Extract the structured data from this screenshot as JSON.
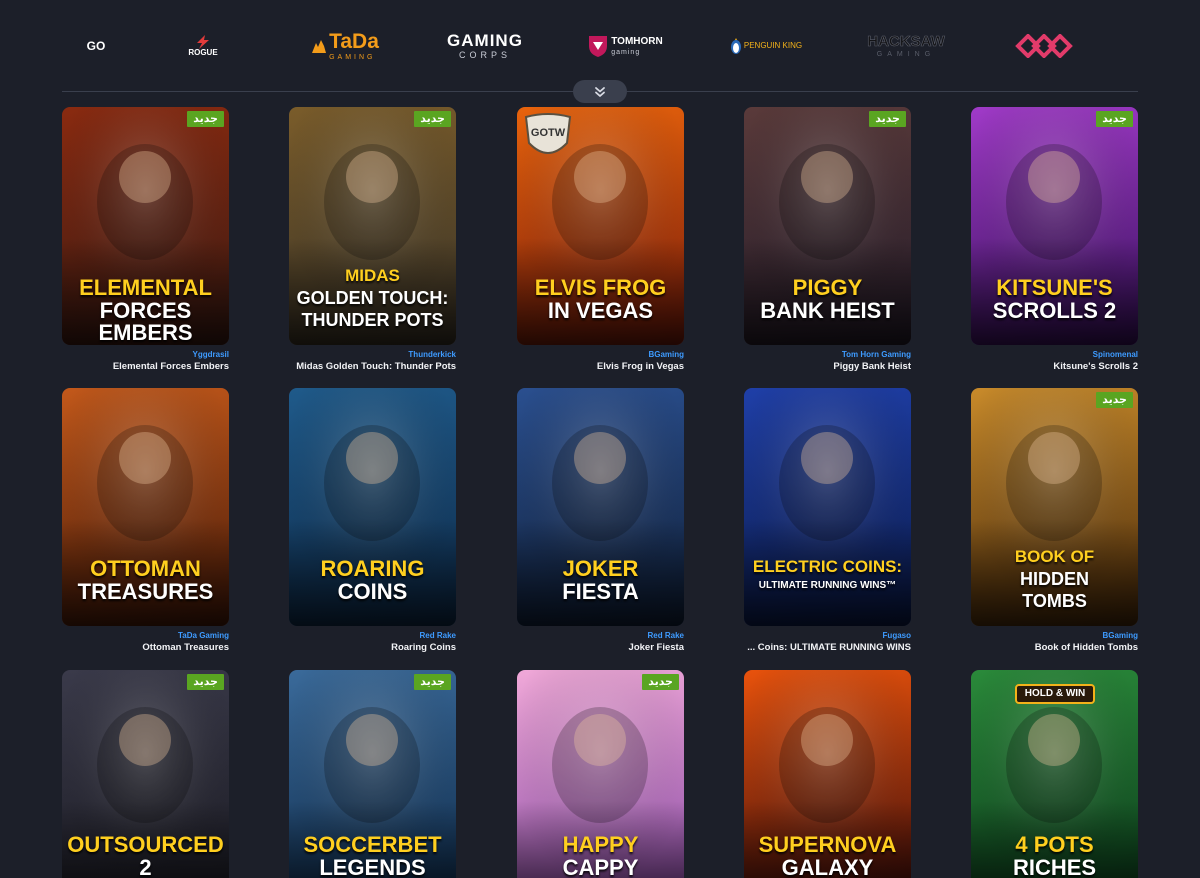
{
  "providers": [
    {
      "main": "GO",
      "sub": ""
    },
    {
      "main": "ROGUE",
      "sub": ""
    },
    {
      "main": "TaDa",
      "sub": "GAMING"
    },
    {
      "main": "GAMING",
      "sub": "CORPS"
    },
    {
      "main": "TOMHORN",
      "sub": "gaming"
    },
    {
      "main": "PENGUIN KING",
      "sub": ""
    },
    {
      "main": "HACKSAW",
      "sub": "GAMING"
    },
    {
      "main": "",
      "sub": ""
    }
  ],
  "expand_icon": "chevron-double-down-icon",
  "new_badge": "جديد",
  "gotw_badge": "GOTW",
  "games": [
    {
      "title_line1": "ELEMENTAL",
      "title_line2": "FORCES EMBERS",
      "provider": "Yggdrasil",
      "name": "Elemental Forces Embers",
      "is_new": true,
      "bg1": "#3b1a12",
      "bg2": "#8a2a10"
    },
    {
      "title_line1": "MIDAS",
      "title_line2": "GOLDEN TOUCH:",
      "title_line3": "THUNDER POTS",
      "provider": "Thunderkick",
      "name": "Midas Golden Touch: Thunder Pots",
      "is_new": true,
      "bg1": "#3a3327",
      "bg2": "#7a5c2a"
    },
    {
      "title_line1": "ELVIS FROG",
      "title_line2": "IN VEGAS",
      "provider": "BGaming",
      "name": "Elvis Frog in Vegas",
      "is_new": false,
      "gotw": true,
      "bg1": "#7a1a0a",
      "bg2": "#e8630c"
    },
    {
      "title_line1": "PIGGY",
      "title_line2": "BANK HEIST",
      "provider": "Tom Horn Gaming",
      "name": "Piggy Bank Heist",
      "is_new": true,
      "bg1": "#251c2a",
      "bg2": "#5a3a3a"
    },
    {
      "title_line1": "KITSUNE'S",
      "title_line2": "SCROLLS 2",
      "provider": "Spinomenal",
      "name": "Kitsune's Scrolls 2",
      "is_new": true,
      "bg1": "#3a1060",
      "bg2": "#a03ac8"
    },
    {
      "title_line1": "OTTOMAN",
      "title_line2": "TREASURES",
      "provider": "TaDa Gaming",
      "name": "Ottoman Treasures",
      "is_new": false,
      "bg1": "#4a1a08",
      "bg2": "#c2581a"
    },
    {
      "title_line1": "ROARING",
      "title_line2": "COINS",
      "provider": "Red Rake",
      "name": "Roaring Coins",
      "is_new": false,
      "bg1": "#0d2a4a",
      "bg2": "#1f5a8a"
    },
    {
      "title_line1": "JOKER",
      "title_line2": "FIESTA",
      "provider": "Red Rake",
      "name": "Joker Fiesta",
      "is_new": false,
      "bg1": "#10203a",
      "bg2": "#2a4f8f"
    },
    {
      "title_line1": "ELECTRIC COINS:",
      "title_line2": "ULTIMATE RUNNING WINS™",
      "provider": "Fugaso",
      "name": "... Coins: ULTIMATE RUNNING WINS",
      "is_new": false,
      "bg1": "#0a1a4a",
      "bg2": "#1f3fa8"
    },
    {
      "title_line1": "BOOK OF",
      "title_line2": "HIDDEN",
      "title_line3": "TOMBS",
      "provider": "BGaming",
      "name": "Book of Hidden Tombs",
      "is_new": true,
      "bg1": "#4a2a0a",
      "bg2": "#c88a2a"
    },
    {
      "title_line1": "OUTSOURCED",
      "title_line2": "2",
      "provider": "",
      "name": "",
      "is_new": true,
      "bg1": "#1a1a22",
      "bg2": "#3a3a4a"
    },
    {
      "title_line1": "SOCCERBET",
      "title_line2": "LEGENDS",
      "provider": "",
      "name": "",
      "is_new": true,
      "bg1": "#0d2a4a",
      "bg2": "#3a6a9a"
    },
    {
      "title_line1": "HAPPY",
      "title_line2": "CAPPY",
      "provider": "",
      "name": "",
      "is_new": true,
      "bg1": "#8a4aa8",
      "bg2": "#f0a8d8"
    },
    {
      "title_line1": "SUPERNOVA",
      "title_line2": "GALAXY",
      "provider": "",
      "name": "",
      "is_new": false,
      "bg1": "#3a0a0a",
      "bg2": "#e8520c"
    },
    {
      "title_line1": "4 POTS",
      "title_line2": "RICHES",
      "provider": "",
      "name": "",
      "is_new": false,
      "hold_win": "HOLD & WIN",
      "bg1": "#0a3a1a",
      "bg2": "#2a8a3a"
    }
  ]
}
